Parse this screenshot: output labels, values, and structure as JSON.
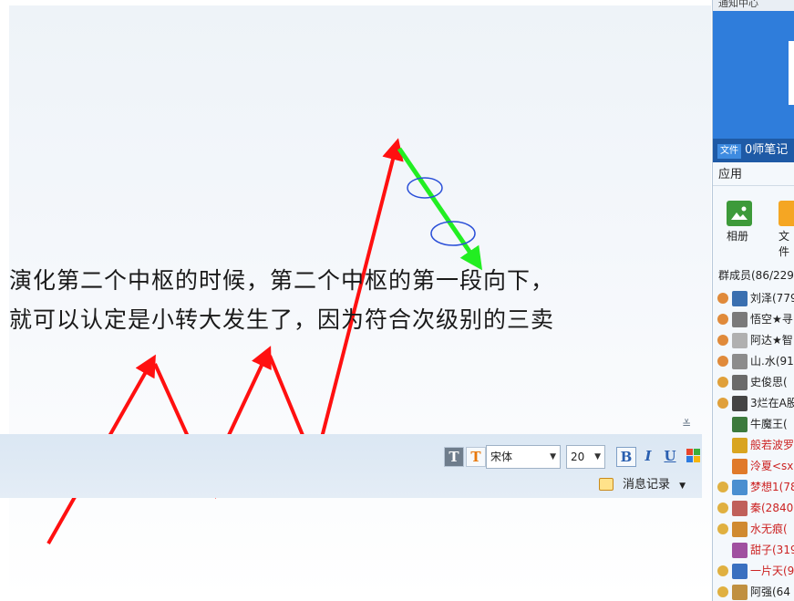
{
  "caption_lines": [
    "演化第二个中枢的时候，第二个中枢的第一段向下，",
    "就可以认定是小转大发生了，因为符合次级别的三卖"
  ],
  "toolbar": {
    "text_style_label": "T",
    "text_color_label": "T",
    "font_family": "宋体",
    "font_size": "20",
    "bold_label": "B",
    "italic_label": "I",
    "underline_label": "U",
    "message_record_label": "消息记录",
    "collapse_glyph": "≚"
  },
  "right_panel": {
    "notice_title": "通知中心",
    "file_badge": "文件",
    "file_name": "0师笔记",
    "apps_title": "应用",
    "apps": [
      {
        "label": "相册",
        "icon": "album-icon"
      },
      {
        "label": "文件",
        "icon": "folder-icon"
      }
    ],
    "members_title": "群成员(86/229",
    "members": [
      {
        "name": "刘泽(779",
        "color": "#222222",
        "role_color": "#e08a3a",
        "avatar_color": "#3a6fb0"
      },
      {
        "name": "悟空★寻",
        "color": "#222222",
        "role_color": "#e08a3a",
        "avatar_color": "#7a7a7a"
      },
      {
        "name": "阿达★智",
        "color": "#222222",
        "role_color": "#e08a3a",
        "avatar_color": "#b0b0b0"
      },
      {
        "name": "山.水(91",
        "color": "#222222",
        "role_color": "#e08a3a",
        "avatar_color": "#8c8c8c"
      },
      {
        "name": "史俊思(",
        "color": "#222222",
        "role_color": "#e0a03a",
        "avatar_color": "#6a6a6a"
      },
      {
        "name": "3烂在A股",
        "color": "#222222",
        "role_color": "#e0a03a",
        "avatar_color": "#444444"
      },
      {
        "name": "牛魔王(",
        "color": "#222222",
        "role_color": "",
        "avatar_color": "#3c7a3c"
      },
      {
        "name": "般若波罗",
        "color": "#cc2222",
        "role_color": "",
        "avatar_color": "#d9a520"
      },
      {
        "name": "泠夏<sx",
        "color": "#cc2222",
        "role_color": "",
        "avatar_color": "#e07a2a"
      },
      {
        "name": "梦想1(78",
        "color": "#cc2222",
        "role_color": "#e0b040",
        "avatar_color": "#4a8fd0"
      },
      {
        "name": "秦(2840",
        "color": "#cc2222",
        "role_color": "#e0b040",
        "avatar_color": "#c0605a"
      },
      {
        "name": "水无痕(",
        "color": "#cc2222",
        "role_color": "#e0b040",
        "avatar_color": "#d08a30"
      },
      {
        "name": "甜子(319",
        "color": "#cc2222",
        "role_color": "",
        "avatar_color": "#a050a0"
      },
      {
        "name": "一片天(9",
        "color": "#cc2222",
        "role_color": "#e0b040",
        "avatar_color": "#3a70c0"
      },
      {
        "name": "阿强(64",
        "color": "#222222",
        "role_color": "#e0b040",
        "avatar_color": "#c09040"
      }
    ]
  },
  "colors": {
    "zigzag_arrows": "#ff1010",
    "down_arrow": "#22ee22",
    "circles": "#2a4fd8",
    "notice_background": "#2f7ddb"
  }
}
